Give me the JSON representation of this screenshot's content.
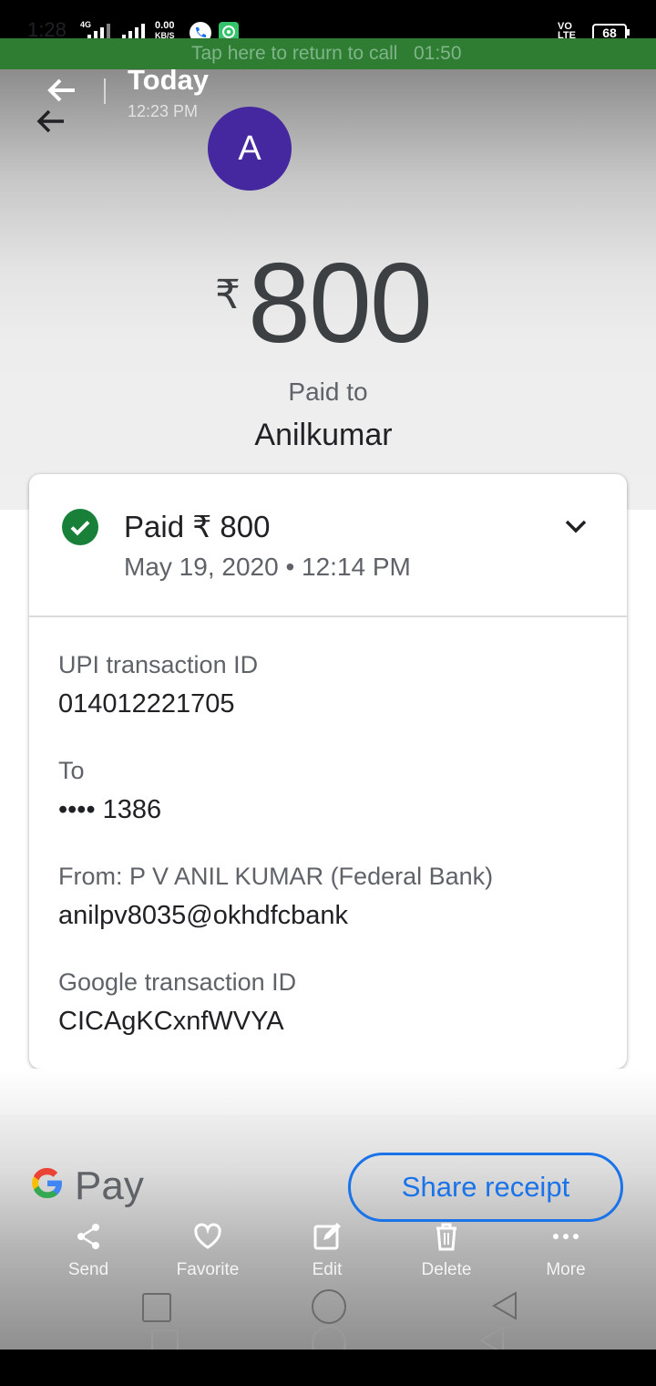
{
  "status_bar": {
    "time": "1:28",
    "network_4g": "4G",
    "speed_value": "0.00",
    "speed_unit": "KB/S",
    "volte": "VO LTE",
    "battery": "68"
  },
  "call_banner": {
    "text": "Tap here to return to call   01:50"
  },
  "header": {
    "title": "Today",
    "time": "12:23 PM"
  },
  "recipient": {
    "avatar_letter": "A",
    "name": "Anilkumar"
  },
  "payment": {
    "currency": "₹",
    "amount": "800",
    "paid_to_label": "Paid to"
  },
  "card": {
    "status_title": "Paid ₹ 800",
    "status_date": "May 19, 2020 • 12:14 PM",
    "details": [
      {
        "label": "UPI transaction ID",
        "value": "014012221705"
      },
      {
        "label": "To",
        "value": "•••• 1386"
      },
      {
        "label": "From: P V ANIL KUMAR (Federal Bank)",
        "value": "anilpv8035@okhdfcbank"
      },
      {
        "label": "Google transaction ID",
        "value": "CICAgKCxnfWVYA"
      }
    ]
  },
  "footer": {
    "brand": "Pay",
    "share_label": "Share receipt",
    "actions": [
      {
        "label": "Send",
        "icon": "share-icon"
      },
      {
        "label": "Favorite",
        "icon": "heart-icon"
      },
      {
        "label": "Edit",
        "icon": "edit-icon"
      },
      {
        "label": "Delete",
        "icon": "trash-icon"
      },
      {
        "label": "More",
        "icon": "more-dots-icon"
      }
    ]
  },
  "colors": {
    "accent_blue": "#1a73e8",
    "success_green": "#188038",
    "avatar_purple": "#4527a0",
    "call_banner_green": "#2e7d32"
  }
}
